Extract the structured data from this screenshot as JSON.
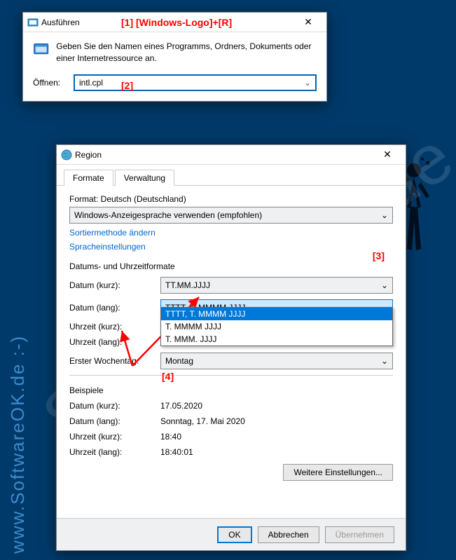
{
  "watermark": {
    "text": "SoftwareOk.de",
    "left": "www.SoftwareOK.de :-)"
  },
  "run": {
    "title": "Ausführen",
    "desc": "Geben Sie den Namen eines Programms, Ordners, Dokuments oder einer Internetressource an.",
    "open_label": "Öffnen:",
    "open_value": "intl.cpl"
  },
  "annot": {
    "a1": "[1]  [Windows-Logo]+[R]",
    "a2": "[2]",
    "a3": "[3]",
    "a4": "[4]"
  },
  "region": {
    "title": "Region",
    "tabs": {
      "formate": "Formate",
      "verwaltung": "Verwaltung"
    },
    "format_label": "Format: Deutsch (Deutschland)",
    "format_select": "Windows-Anzeigesprache verwenden (empfohlen)",
    "link_sort": "Sortiermethode ändern",
    "link_lang": "Spracheinstellungen",
    "group_dt": "Datums- und Uhrzeitformate",
    "rows": {
      "date_short_label": "Datum (kurz):",
      "date_short_val": "TT.MM.JJJJ",
      "date_long_label": "Datum (lang):",
      "date_long_val": "TTTT, T. MMMM JJJJ",
      "time_short_label": "Uhrzeit (kurz):",
      "time_long_label": "Uhrzeit (lang):",
      "dow_label": "Erster Wochentag:",
      "dow_val": "Montag"
    },
    "dropdown": {
      "opt1": "TTTT, T. MMMM JJJJ",
      "opt2": "T. MMMM JJJJ",
      "opt3": "T. MMM. JJJJ"
    },
    "examples_title": "Beispiele",
    "examples": {
      "date_short_label": "Datum (kurz):",
      "date_short_val": "17.05.2020",
      "date_long_label": "Datum (lang):",
      "date_long_val": "Sonntag, 17. Mai 2020",
      "time_short_label": "Uhrzeit (kurz):",
      "time_short_val": "18:40",
      "time_long_label": "Uhrzeit (lang):",
      "time_long_val": "18:40:01"
    },
    "btn_more": "Weitere Einstellungen...",
    "btn_ok": "OK",
    "btn_cancel": "Abbrechen",
    "btn_apply": "Übernehmen"
  }
}
